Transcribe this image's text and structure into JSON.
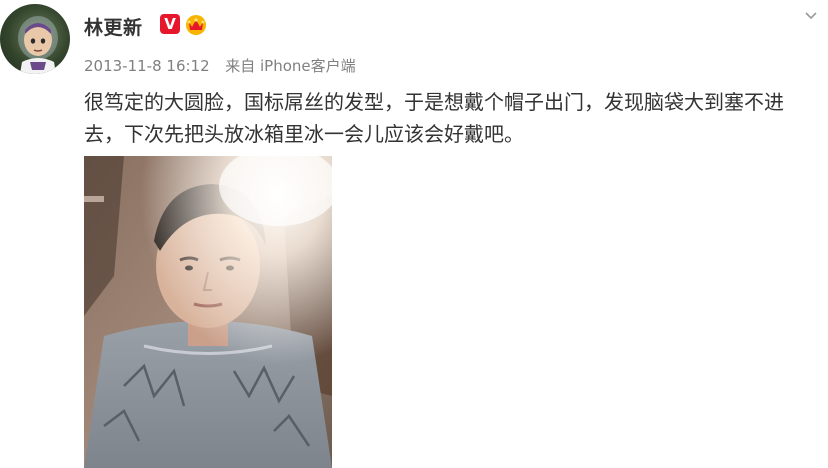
{
  "user": {
    "name": "林更新",
    "verified_badge": "V",
    "avatar_icon": "buzz-lightyear-avatar",
    "vip_icon": "crown-badge-icon"
  },
  "post": {
    "timestamp": "2013-11-8 16:12",
    "source_prefix": "来自",
    "source": "iPhone客户端",
    "text": "很笃定的大圆脸，国标屌丝的发型，于是想戴个帽子出门，发现脑袋大到塞不进去，下次先把头放冰箱里冰一会儿应该会好戴吧。",
    "photo_icon": "selfie-photo"
  },
  "controls": {
    "close_icon": "chevron-down-icon"
  },
  "colors": {
    "badge_red": "#e6162d",
    "meta_gray": "#808080",
    "text_dark": "#333333"
  }
}
